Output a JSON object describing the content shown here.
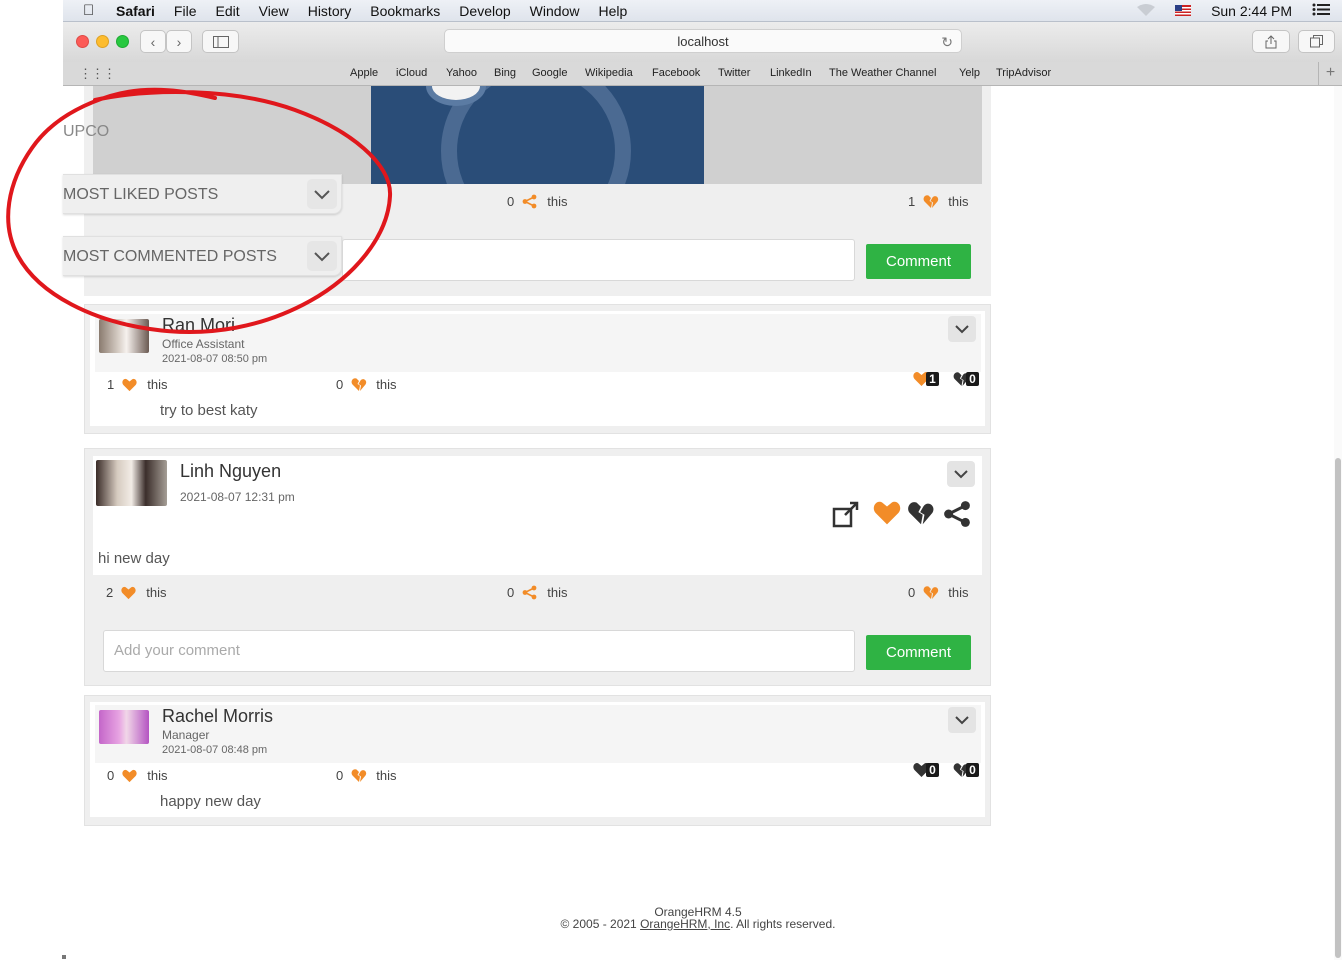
{
  "menubar": {
    "app": "Safari",
    "items": [
      "File",
      "Edit",
      "View",
      "History",
      "Bookmarks",
      "Develop",
      "Window",
      "Help"
    ],
    "clock": "Sun 2:44 PM"
  },
  "browser": {
    "url": "localhost",
    "bookmarks": [
      "Apple",
      "iCloud",
      "Yahoo",
      "Bing",
      "Google",
      "Wikipedia",
      "Facebook",
      "Twitter",
      "LinkedIn",
      "The Weather Channel",
      "Yelp",
      "TripAdvisor"
    ]
  },
  "sidebar": {
    "upcoming_label": "UPCO",
    "most_liked": "MOST LIKED POSTS",
    "most_commented": "MOST COMMENTED POSTS"
  },
  "top_post": {
    "shares": "0",
    "dislikes": "1",
    "this": "this",
    "comment_button": "Comment"
  },
  "posts": [
    {
      "name": "Ran Mori",
      "job": "Office Assistant",
      "date": "2021-08-07 08:50 pm",
      "likes": "1",
      "dislikes": "0",
      "this": "this",
      "text": "try to best katy",
      "badge_likes": "1",
      "badge_dislikes": "0"
    },
    {
      "name": "Linh Nguyen",
      "date": "2021-08-07  12:31 pm",
      "text": "hi new day",
      "likes": "2",
      "shares": "0",
      "dislikes": "0",
      "this": "this",
      "comment_placeholder": "Add your comment",
      "comment_button": "Comment"
    },
    {
      "name": "Rachel Morris",
      "job": "Manager",
      "date": "2021-08-07 08:48 pm",
      "likes": "0",
      "dislikes": "0",
      "this": "this",
      "text": "happy new day",
      "badge_likes": "0",
      "badge_dislikes": "0"
    }
  ],
  "footer": {
    "version": "OrangeHRM 4.5",
    "copyright_prefix": "© 2005 - 2021 ",
    "company_link": "OrangeHRM, Inc",
    "copyright_suffix": ". All rights reserved."
  },
  "colors": {
    "accent_orange": "#f28c28",
    "comment_green": "#2fb344",
    "annotation_red": "#e0171c"
  }
}
